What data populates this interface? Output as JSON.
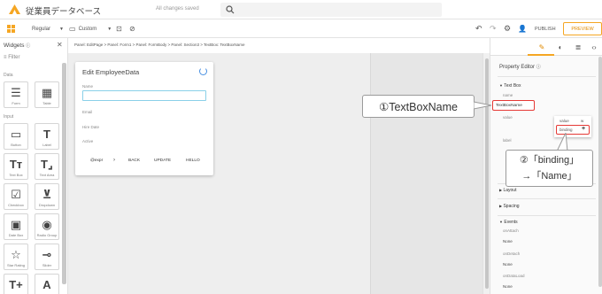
{
  "header": {
    "app_title": "従業員データベース",
    "save_status": "All changes saved"
  },
  "toolbar": {
    "style_select": "Regular",
    "device_select": "Custom",
    "publish_label": "PUBLISH",
    "preview_label": "PREVIEW",
    "accent": "#f5a623"
  },
  "widgets": {
    "title": "Widgets",
    "filter_placeholder": "Filter",
    "sections": {
      "data": "Data",
      "input": "Input"
    },
    "items": [
      {
        "label": "Form",
        "icon": "form-icon",
        "glyph": "☰"
      },
      {
        "label": "Table",
        "icon": "table-icon",
        "glyph": "▦"
      },
      {
        "label": "Button",
        "icon": "button-icon",
        "glyph": "▭"
      },
      {
        "label": "Label",
        "icon": "label-icon",
        "glyph": "T"
      },
      {
        "label": "Text Box",
        "icon": "text-box-icon",
        "glyph": "Tт"
      },
      {
        "label": "Text Area",
        "icon": "text-area-icon",
        "glyph": "T⌟"
      },
      {
        "label": "Checkbox",
        "icon": "checkbox-icon",
        "glyph": "☑"
      },
      {
        "label": "Dropdown",
        "icon": "dropdown-icon",
        "glyph": "⊻"
      },
      {
        "label": "Date Box",
        "icon": "date-box-icon",
        "glyph": "▣"
      },
      {
        "label": "Radio Group",
        "icon": "radio-group-icon",
        "glyph": "◉"
      },
      {
        "label": "Star Rating",
        "icon": "star-rating-icon",
        "glyph": "☆"
      },
      {
        "label": "Slider",
        "icon": "slider-icon",
        "glyph": "⊸"
      },
      {
        "label": "",
        "icon": "text-plus-icon",
        "glyph": "T+"
      },
      {
        "label": "",
        "icon": "font-icon",
        "glyph": "A"
      }
    ]
  },
  "breadcrumb": "Panel: EditPage > Panel: Form1 > Panel: FormBody > Panel: Section3 > TextBox: TextBoxName",
  "form": {
    "title": "Edit EmployeeData",
    "fields": [
      "Name",
      "Email",
      "Hire Date",
      "Active"
    ],
    "buttons": [
      "@expr",
      "›",
      "BACK",
      "UPDATE",
      "HELLO"
    ]
  },
  "property_editor": {
    "title": "Property Editor",
    "text_box_section": "Text Box",
    "name_label": "name",
    "name_value": "TextBoxName",
    "value_label": "value",
    "label_label": "label",
    "sections": [
      "Layout",
      "Spacing",
      "Events"
    ],
    "events": [
      {
        "label": "onAttach",
        "value": "None"
      },
      {
        "label": "onDetach",
        "value": "None"
      },
      {
        "label": "onDataLoad",
        "value": "None"
      }
    ],
    "popup": {
      "value_text": "value",
      "w_text": "w",
      "binding_text": "binding",
      "plus": "+"
    }
  },
  "callouts": {
    "first": "①TextBoxName",
    "second_line1": "②「binding」",
    "second_line2": "→「Name」"
  }
}
